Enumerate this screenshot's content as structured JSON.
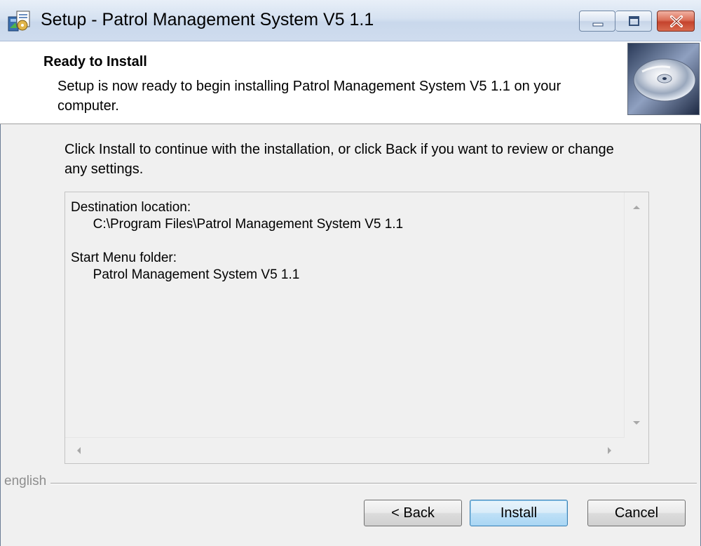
{
  "window": {
    "title": "Setup - Patrol Management System V5 1.1"
  },
  "header": {
    "title": "Ready to Install",
    "subtitle": "Setup is now ready to begin installing Patrol Management System V5 1.1 on your computer."
  },
  "content": {
    "instructions": "Click Install to continue with the installation, or click Back if you want to review or change any settings.",
    "memo": "Destination location:\n      C:\\Program Files\\Patrol Management System V5 1.1\n\nStart Menu folder:\n      Patrol Management System V5 1.1"
  },
  "footer": {
    "language": "english",
    "back_label": "< Back",
    "install_label": "Install",
    "cancel_label": "Cancel"
  },
  "colors": {
    "titlebar": "#d6e2f1",
    "close_button": "#c4432d",
    "default_button_border": "#3c7fb1"
  },
  "icons": [
    "setup-app-icon",
    "minimize-icon",
    "maximize-icon",
    "close-icon",
    "cd-disc-icon",
    "scroll-up-icon",
    "scroll-down-icon",
    "scroll-left-icon",
    "scroll-right-icon"
  ]
}
